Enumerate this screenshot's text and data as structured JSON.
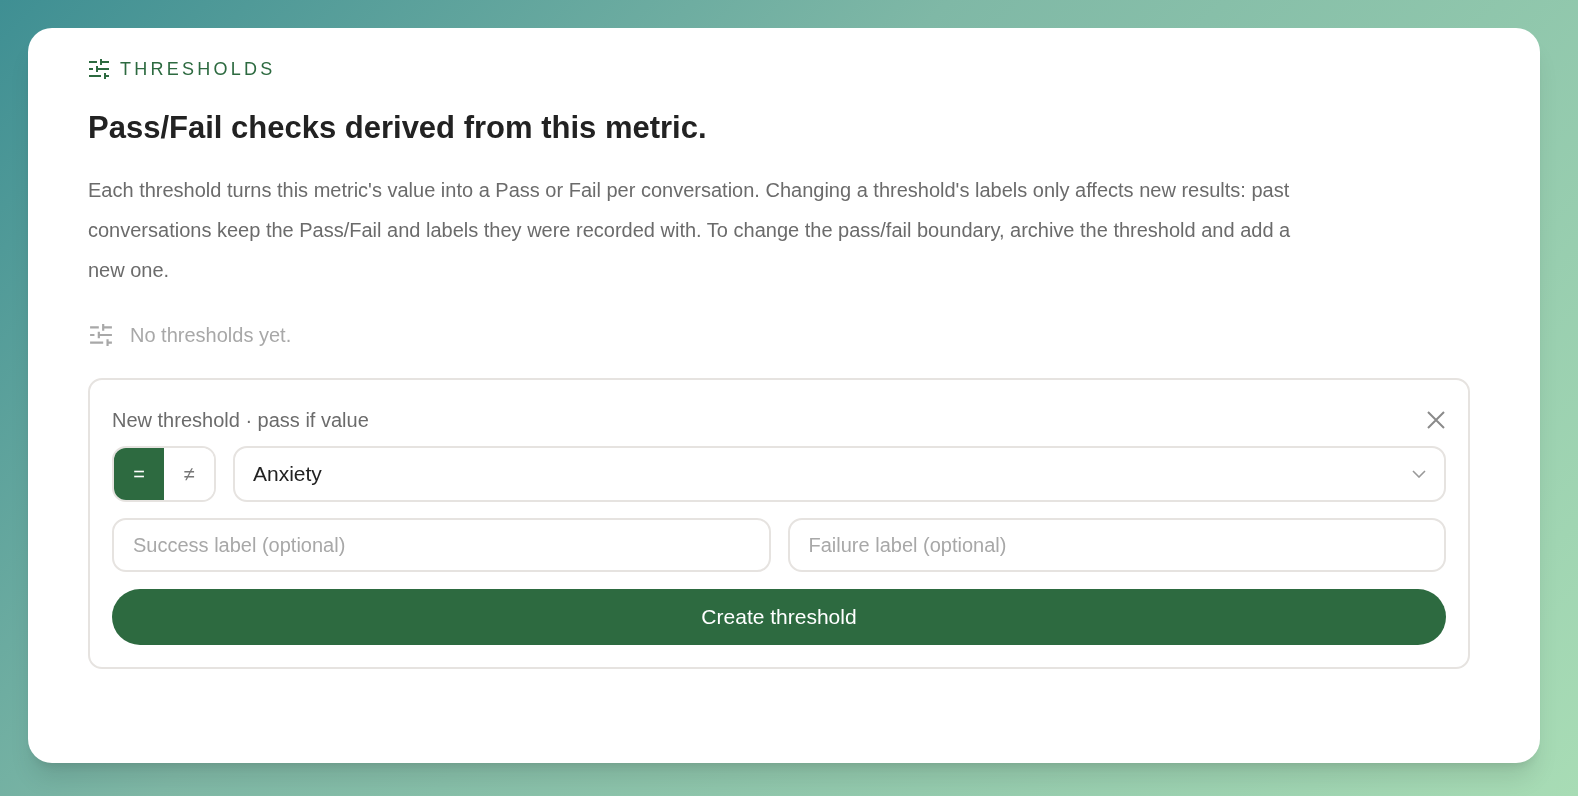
{
  "section": {
    "label": "THRESHOLDS",
    "title": "Pass/Fail checks derived from this metric.",
    "description": "Each threshold turns this metric's value into a Pass or Fail per conversation. Changing a threshold's labels only affects new results: past conversations keep the Pass/Fail and labels they were recorded with. To change the pass/fail boundary, archive the threshold and add a new one."
  },
  "empty_state": "No thresholds yet.",
  "form": {
    "title": "New threshold · pass if value",
    "operators": [
      {
        "label": "=",
        "selected": true
      },
      {
        "label": "≠",
        "selected": false
      }
    ],
    "value_select": "Anxiety",
    "success_label": {
      "placeholder": "Success label (optional)"
    },
    "failure_label": {
      "placeholder": "Failure label (optional)"
    },
    "submit": "Create threshold"
  }
}
